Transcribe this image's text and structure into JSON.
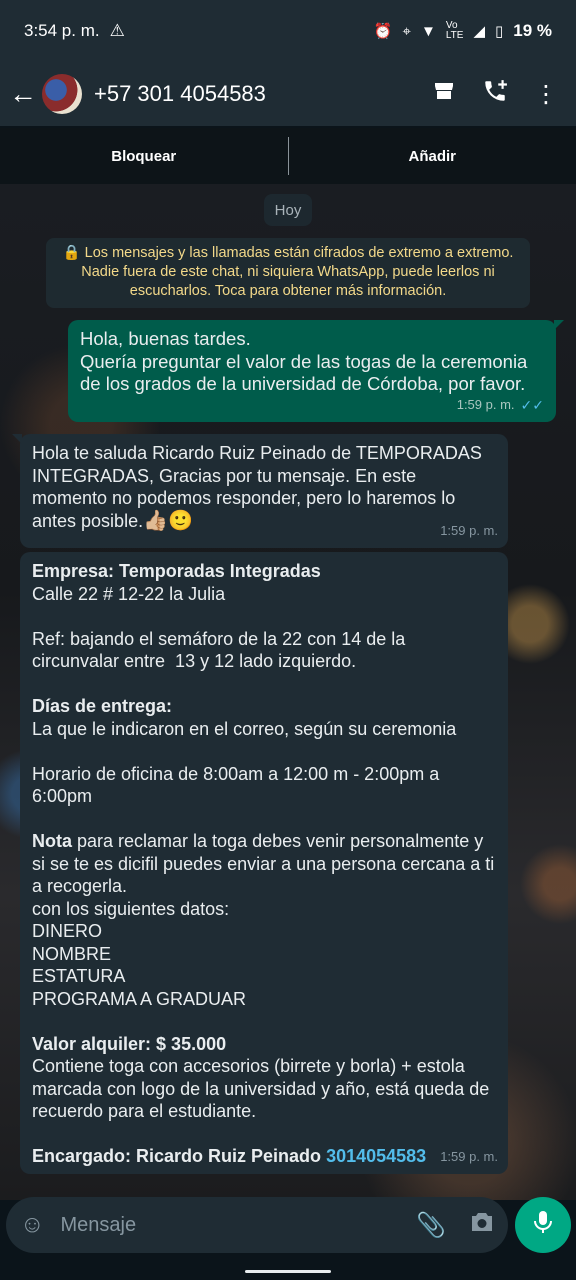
{
  "status_bar": {
    "time": "3:54 p. m.",
    "warning_icon": "warning-triangle-icon",
    "battery": "19 %"
  },
  "header": {
    "contact": "+57 301 4054583",
    "icons": [
      "back-arrow-icon",
      "avatar",
      "store-icon",
      "add-call-icon",
      "more-vert-icon"
    ]
  },
  "action_bar": {
    "block_label": "Bloquear",
    "add_label": "Añadir"
  },
  "chat": {
    "date_chip": "Hoy",
    "encryption_notice": "🔒 Los mensajes y las llamadas están cifrados de extremo a extremo. Nadie fuera de este chat, ni siquiera WhatsApp, puede leerlos ni escucharlos. Toca para obtener más información.",
    "outgoing": {
      "lines": [
        "Hola, buenas tardes.",
        "Quería preguntar el valor de las togas de la ceremonia de los grados de la universidad de Córdoba, por favor."
      ],
      "time": "1:59 p. m."
    },
    "incoming_1": {
      "text": "Hola te saluda Ricardo Ruiz Peinado de TEMPORADAS INTEGRADAS, Gracias por tu mensaje. En este momento no podemos responder, pero lo haremos lo antes posible.",
      "emoji": "👍🏼🙂",
      "time": "1:59 p. m."
    },
    "incoming_2": {
      "empresa_label": "Empresa: Temporadas Integradas",
      "address": "Calle 22 # 12-22 la Julia",
      "ref": "Ref: bajando el semáforo de la 22 con 14 de la circunvalar entre  13 y 12 lado izquierdo.",
      "dias_label": "Días de entrega:",
      "dias_text": "La que le indicaron en el correo, según su ceremonia",
      "horario": "Horario de oficina de 8:00am a 12:00 m - 2:00pm a 6:00pm",
      "nota_label": "Nota",
      "nota_text": " para reclamar la toga debes venir personalmente y si se te es dicifil puedes enviar a una persona cercana a ti a recogerla.",
      "datos_intro": "con los siguientes datos:",
      "datos": [
        "DINERO",
        "NOMBRE",
        "ESTATURA",
        "PROGRAMA A GRADUAR"
      ],
      "valor_label": "Valor alquiler: $ 35.000",
      "valor_text": "Contiene toga con accesorios (birrete y borla) + estola marcada con logo de la universidad y año, está queda de recuerdo para el estudiante.",
      "encargado_label": "Encargado: Ricardo Ruiz Peinado",
      "encargado_phone": "3014054583",
      "time": "1:59 p. m."
    }
  },
  "composer": {
    "placeholder": "Mensaje"
  }
}
